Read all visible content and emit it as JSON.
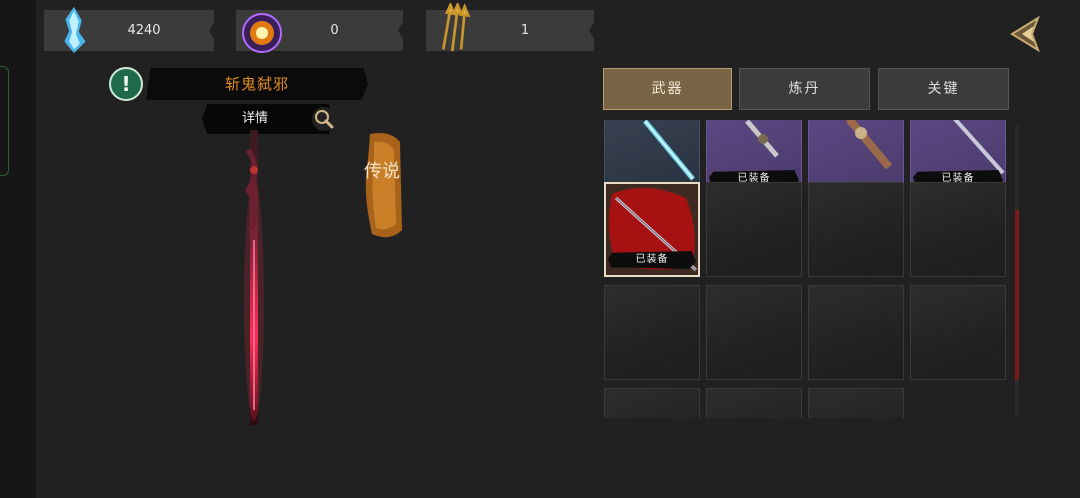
{
  "resources": {
    "crystal": {
      "icon": "blue-crystal-icon",
      "value": "4240"
    },
    "orb": {
      "icon": "fire-orb-icon",
      "value": "0"
    },
    "arrows": {
      "icon": "golden-arrows-icon",
      "value": "1"
    }
  },
  "weapon": {
    "name": "斩鬼弑邪",
    "details_label": "详情",
    "rarity": "传说"
  },
  "tabs": [
    {
      "label": "武器",
      "active": true
    },
    {
      "label": "炼丹",
      "active": false
    },
    {
      "label": "关键",
      "active": false
    }
  ],
  "inventory": {
    "equipped_label": "已装备",
    "slots": [
      {
        "rarity": "blue",
        "equipped": false,
        "item": "crystal-blade-icon"
      },
      {
        "rarity": "purple",
        "equipped": true,
        "item": "dagger-icon"
      },
      {
        "rarity": "purple",
        "equipped": false,
        "item": "ornate-hilt-icon"
      },
      {
        "rarity": "purple",
        "equipped": true,
        "item": "sword-icon"
      },
      {
        "rarity": "red",
        "equipped": true,
        "item": "red-spear-icon",
        "selected": true
      },
      {
        "rarity": "empty"
      },
      {
        "rarity": "empty"
      },
      {
        "rarity": "empty"
      },
      {
        "rarity": "empty"
      },
      {
        "rarity": "empty"
      },
      {
        "rarity": "empty"
      },
      {
        "rarity": "empty"
      },
      {
        "rarity": "empty"
      },
      {
        "rarity": "empty"
      },
      {
        "rarity": "empty"
      }
    ]
  },
  "colors": {
    "accent_orange": "#e08a22",
    "legendary_red": "#c01818",
    "tab_active": "#7a6446"
  }
}
